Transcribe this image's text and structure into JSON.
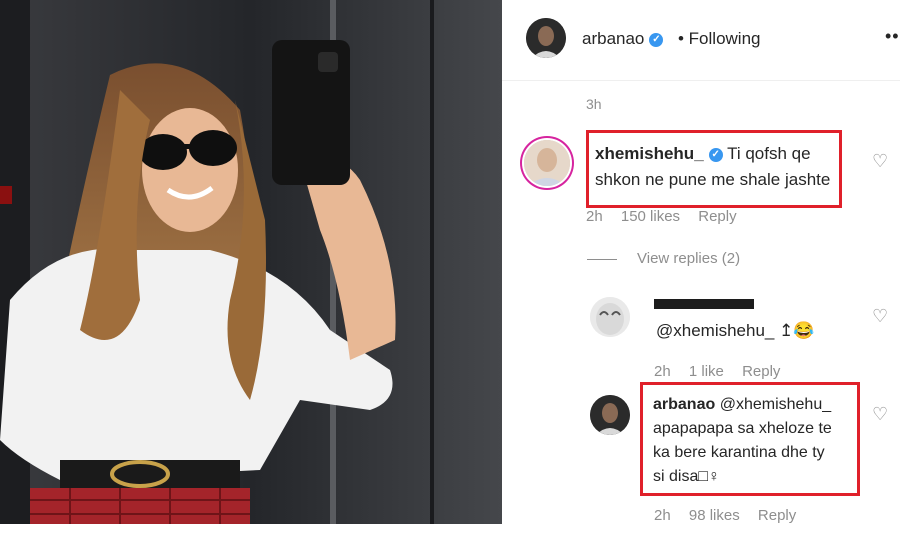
{
  "post": {
    "username": "arbanao",
    "follow_status": "• Following",
    "more_icon": "more-icon",
    "time_ago": "3h"
  },
  "comments": [
    {
      "username": "xhemishehu_",
      "verified": true,
      "text_line1": "Ti qofsh qe",
      "text_line2": "shkon ne pune me shale jashte",
      "time": "2h",
      "likes": "150 likes",
      "reply": "Reply"
    }
  ],
  "view_replies": "View replies (2)",
  "replies": [
    {
      "username": "",
      "text": "@xhemishehu_ ↥😂",
      "time": "2h",
      "likes": "1 like",
      "reply": "Reply"
    },
    {
      "username": "arbanao",
      "text_line1": "@xhemishehu_",
      "text_line2": "apapapapa sa xheloze te",
      "text_line3": "ka bere karantina dhe ty",
      "text_line4": "si disa□♀",
      "time": "2h",
      "likes": "98 likes",
      "reply": "Reply"
    }
  ],
  "colors": {
    "highlight": "#e0202a",
    "verified": "#3897f0",
    "muted": "#8e8e8e"
  }
}
